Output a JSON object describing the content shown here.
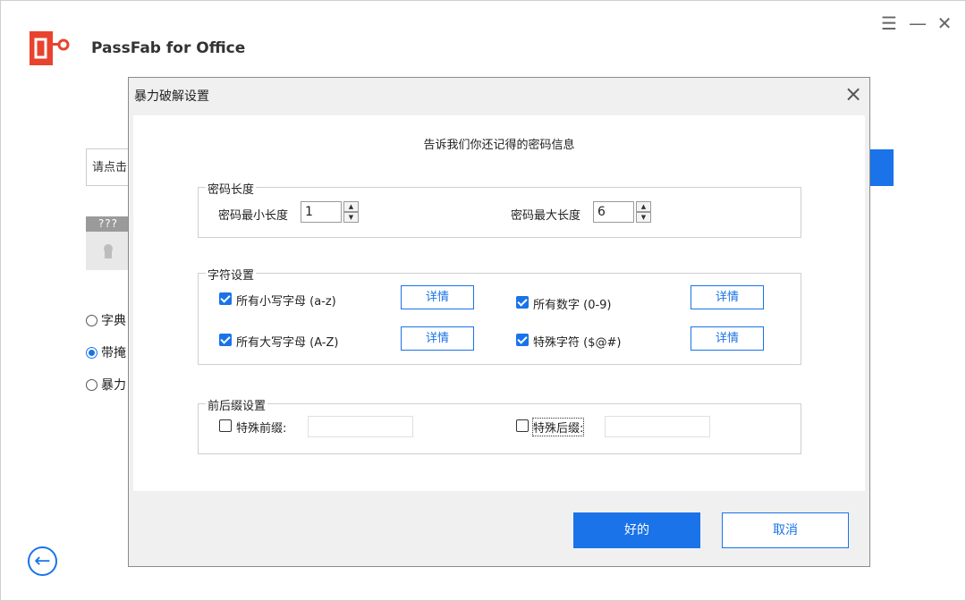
{
  "app": {
    "title": "PassFab for Office",
    "brand_color": "#e8432e",
    "accent_color": "#1a73e8",
    "window_controls": [
      "menu-icon",
      "minimize-icon",
      "close-icon"
    ]
  },
  "background": {
    "input_text": "请点击",
    "file_label": "???",
    "radios": [
      {
        "label": "字典",
        "selected": false
      },
      {
        "label": "带掩",
        "selected": true
      },
      {
        "label": "暴力",
        "selected": false
      }
    ],
    "back_icon": "arrow-left-icon"
  },
  "dialog": {
    "title": "暴力破解设置",
    "subtitle": "告诉我们你还记得的密码信息",
    "length_group": {
      "legend": "密码长度",
      "min_label": "密码最小长度",
      "min_value": "1",
      "max_label": "密码最大长度",
      "max_value": "6"
    },
    "charset_group": {
      "legend": "字符设置",
      "items": [
        {
          "label": "所有小写字母 (a-z)",
          "checked": true,
          "detail": "详情"
        },
        {
          "label": "所有数字 (0-9)",
          "checked": true,
          "detail": "详情"
        },
        {
          "label": "所有大写字母 (A-Z)",
          "checked": true,
          "detail": "详情"
        },
        {
          "label": "特殊字符 ($@#)",
          "checked": true,
          "detail": "详情"
        }
      ]
    },
    "affix_group": {
      "legend": "前后缀设置",
      "prefix_label": "特殊前缀:",
      "prefix_checked": false,
      "prefix_value": "",
      "suffix_label": "特殊后缀:",
      "suffix_checked": false,
      "suffix_value": ""
    },
    "ok_label": "好的",
    "cancel_label": "取消"
  }
}
